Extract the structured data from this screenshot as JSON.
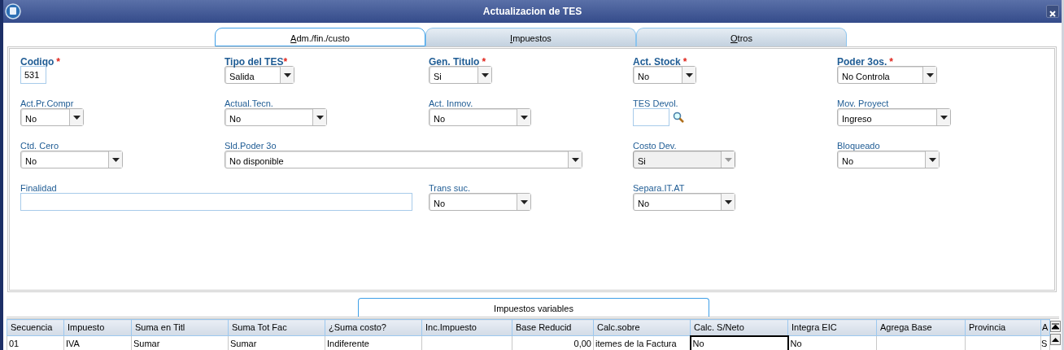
{
  "window": {
    "title": "Actualizacion de TES"
  },
  "tabs": [
    {
      "label": "Adm./fin./custo",
      "selected": true
    },
    {
      "label": "Impuestos",
      "selected": false
    },
    {
      "label": "Otros",
      "selected": false
    }
  ],
  "fields": [
    {
      "label": "Codigo",
      "required_mark": "*",
      "kind": "text",
      "value": "531",
      "disabled": false
    },
    {
      "label": "Tipo del TES",
      "required_mark": "*",
      "kind": "select",
      "value": "Salida",
      "disabled": false
    },
    {
      "label": "Gen. Titulo",
      "required_mark": "*",
      "kind": "select",
      "value": "Si",
      "disabled": false
    },
    {
      "label": "Act. Stock",
      "required_mark": "*",
      "kind": "select",
      "value": "No",
      "disabled": false
    },
    {
      "label": "Poder 3os.",
      "required_mark": "*",
      "kind": "select",
      "value": "No Controla",
      "disabled": false
    },
    {
      "label": "Act.Pr.Compr",
      "kind": "select",
      "value": "No",
      "disabled": false
    },
    {
      "label": "Actual.Tecn.",
      "kind": "select",
      "value": "No",
      "disabled": false
    },
    {
      "label": "Act. Inmov.",
      "kind": "select",
      "value": "No",
      "disabled": false
    },
    {
      "label": "TES Devol.",
      "kind": "lookup",
      "disabled": false
    },
    {
      "label": "Mov. Proyect",
      "kind": "select",
      "value": "Ingreso",
      "disabled": false
    },
    {
      "label": "Ctd. Cero",
      "kind": "select",
      "value": "No",
      "disabled": false
    },
    {
      "label": "Sld.Poder 3o",
      "kind": "select",
      "value": "No disponible",
      "disabled": false
    },
    {
      "label": "Costo Dev.",
      "kind": "select",
      "value": "Si",
      "disabled": true
    },
    {
      "label": "Bloqueado",
      "kind": "select",
      "value": "No",
      "disabled": false
    },
    {
      "label": "Finalidad",
      "kind": "text",
      "disabled": false
    },
    {
      "label": "Trans suc.",
      "kind": "select",
      "value": "No",
      "disabled": false
    },
    {
      "label": "Separa.IT.AT",
      "kind": "select",
      "value": "No",
      "disabled": false
    }
  ],
  "grid_tab": {
    "label": "Impuestos variables"
  },
  "table": {
    "columns": [
      "Secuencia",
      "Impuesto",
      "Suma en Titl",
      "Suma Tot Fac",
      "¿Suma costo?",
      "Inc.Impuesto",
      "Base Reducid",
      "Calc.sobre",
      "Calc. S/Neto",
      "Integra EIC",
      "Agrega Base",
      "Provincia",
      "A"
    ],
    "rows": [
      {
        "cells": [
          {
            "text": "01",
            "selected": false
          },
          {
            "text": "IVA",
            "selected": false
          },
          {
            "text": "Sumar",
            "selected": false
          },
          {
            "text": "Sumar",
            "selected": false
          },
          {
            "text": "Indiferente",
            "selected": false
          },
          {
            "selected": false
          },
          {
            "text": "0,00",
            "selected": false
          },
          {
            "text": "itemes de la Factura",
            "selected": false
          },
          {
            "text": "No",
            "selected": true
          },
          {
            "text": "No",
            "selected": false
          },
          {
            "selected": false
          },
          {
            "selected": false
          },
          {
            "text": "S",
            "selected": false
          }
        ]
      }
    ]
  }
}
